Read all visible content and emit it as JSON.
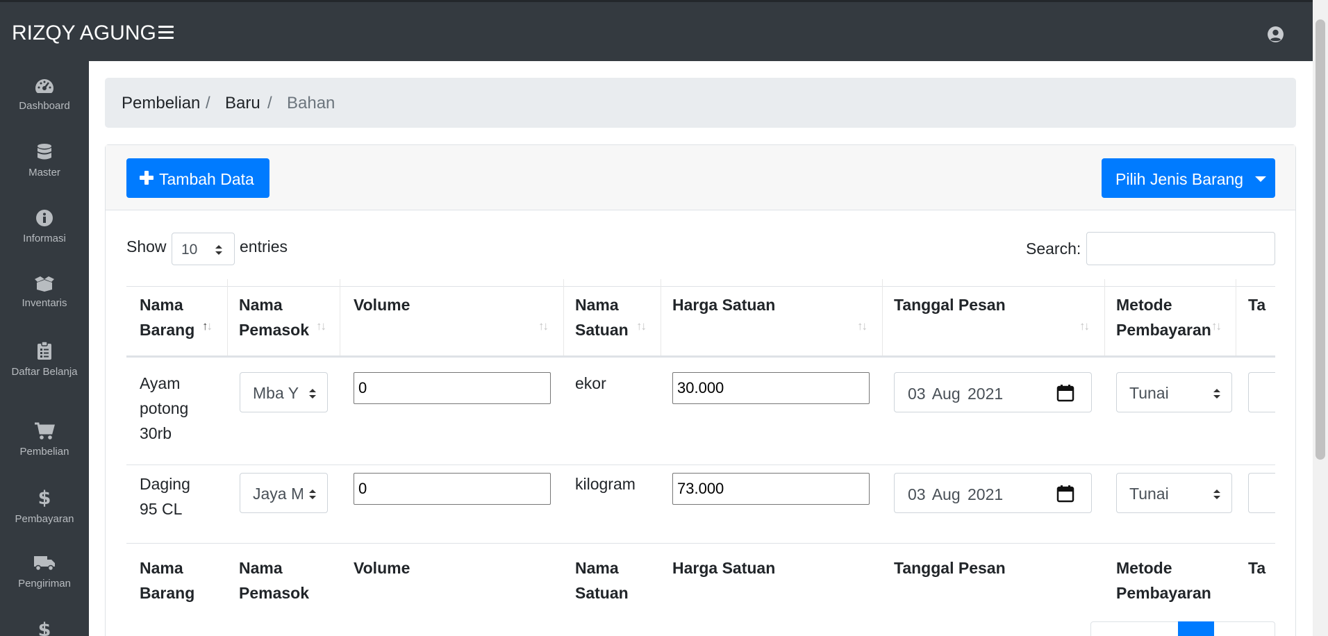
{
  "app": {
    "brand": "RIZQY AGUNG"
  },
  "sidebar": {
    "items": [
      {
        "label": "Dashboard",
        "icon": "tachometer-icon"
      },
      {
        "label": "Master",
        "icon": "database-icon"
      },
      {
        "label": "Informasi",
        "icon": "info-circle-icon"
      },
      {
        "label": "Inventaris",
        "icon": "box-open-icon"
      },
      {
        "label": "Daftar Belanja",
        "icon": "clipboard-list-icon"
      },
      {
        "label": "Pembelian",
        "icon": "shopping-cart-icon"
      },
      {
        "label": "Pembayaran",
        "icon": "dollar-sign-icon"
      },
      {
        "label": "Pengiriman",
        "icon": "truck-icon"
      }
    ]
  },
  "breadcrumb": {
    "items": [
      "Pembelian",
      "Baru",
      "Bahan"
    ],
    "separator": "/"
  },
  "toolbar": {
    "add_label": "Tambah Data",
    "jenis_label": "Pilih Jenis Barang"
  },
  "datatable": {
    "show_label": "Show",
    "entries_label": "entries",
    "length_value": "10",
    "search_label": "Search:",
    "search_value": ""
  },
  "table": {
    "headers": [
      {
        "line1": "Nama",
        "line2": "Barang"
      },
      {
        "line1": "Nama",
        "line2": "Pemasok"
      },
      {
        "line1": "",
        "line2": "Volume"
      },
      {
        "line1": "Nama",
        "line2": "Satuan"
      },
      {
        "line1": "",
        "line2": "Harga Satuan"
      },
      {
        "line1": "",
        "line2": "Tanggal Pesan"
      },
      {
        "line1": "Metode",
        "line2": "Pembayaran"
      },
      {
        "line1": "",
        "line2": "Ta"
      }
    ],
    "footers": [
      {
        "line1": "Nama",
        "line2": "Barang"
      },
      {
        "line1": "Nama",
        "line2": "Pemasok"
      },
      {
        "line1": "Volume",
        "line2": ""
      },
      {
        "line1": "Nama",
        "line2": "Satuan"
      },
      {
        "line1": "Harga Satuan",
        "line2": ""
      },
      {
        "line1": "Tanggal Pesan",
        "line2": ""
      },
      {
        "line1": "Metode",
        "line2": "Pembayaran"
      },
      {
        "line1": "Ta",
        "line2": ""
      }
    ],
    "rows": [
      {
        "nama_barang": [
          "Ayam",
          "potong",
          "30rb"
        ],
        "pemasok": "Mba Y",
        "volume": "0",
        "satuan": "ekor",
        "harga": "30.000",
        "tanggal": "03 Aug 2021",
        "metode": "Tunai"
      },
      {
        "nama_barang": [
          "Daging",
          "95 CL"
        ],
        "pemasok": "Jaya M",
        "volume": "0",
        "satuan": "kilogram",
        "harga": "73.000",
        "tanggal": "03 Aug 2021",
        "metode": "Tunai"
      }
    ]
  },
  "colors": {
    "primary": "#007bff",
    "sidebar_bg": "#343a40",
    "breadcrumb_bg": "#e9ecef"
  }
}
